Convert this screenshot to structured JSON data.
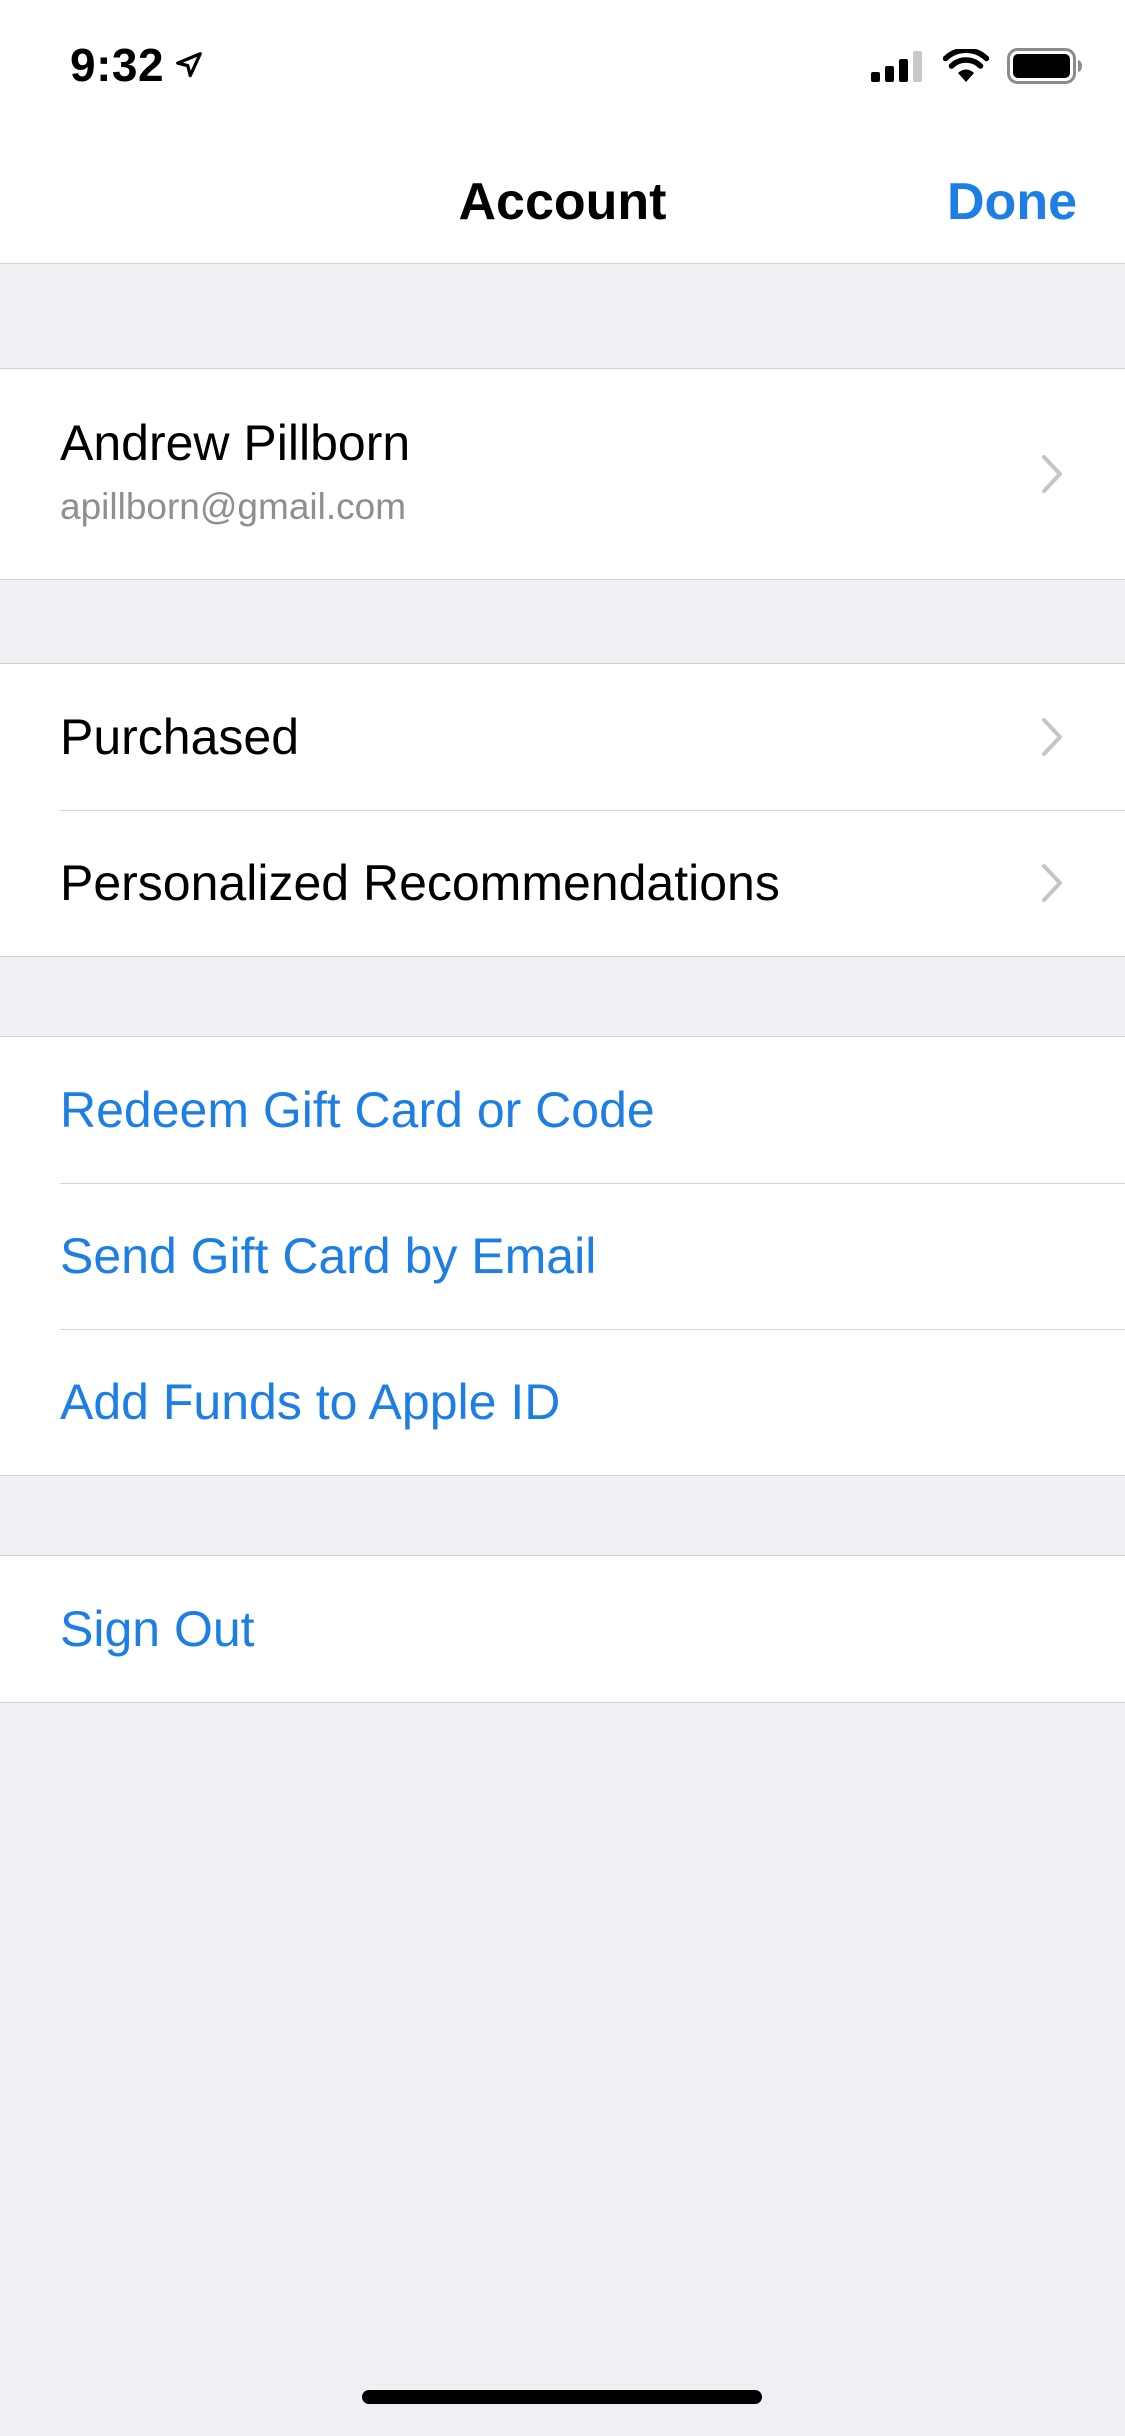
{
  "status_bar": {
    "time": "9:32",
    "location_icon": "location-arrow-icon",
    "signal_icon": "cellular-signal-icon",
    "wifi_icon": "wifi-icon",
    "battery_icon": "battery-icon"
  },
  "nav": {
    "title": "Account",
    "done_label": "Done"
  },
  "account": {
    "name": "Andrew Pillborn",
    "email": "apillborn@gmail.com"
  },
  "store_section": {
    "items": [
      {
        "label": "Purchased"
      },
      {
        "label": "Personalized Recommendations"
      }
    ]
  },
  "gift_section": {
    "items": [
      {
        "label": "Redeem Gift Card or Code"
      },
      {
        "label": "Send Gift Card by Email"
      },
      {
        "label": "Add Funds to Apple ID"
      }
    ]
  },
  "signout_section": {
    "label": "Sign Out"
  },
  "colors": {
    "accent": "#1d7fe5",
    "background": "#efeff4",
    "secondary_text": "#8e8e93"
  }
}
